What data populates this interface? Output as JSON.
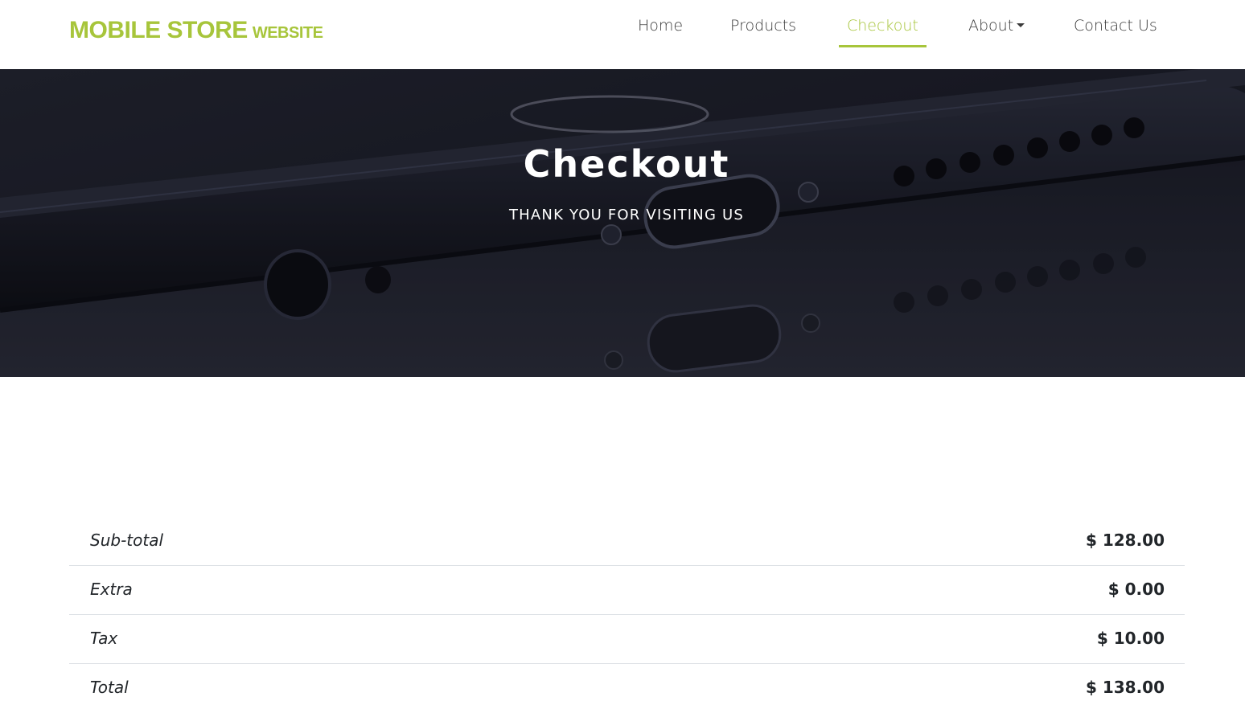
{
  "brand": {
    "name": "MOBILE STORE",
    "suffix": "WEBSITE",
    "color": "#a7c53b"
  },
  "nav": {
    "items": [
      {
        "label": "Home",
        "active": false
      },
      {
        "label": "Products",
        "active": false
      },
      {
        "label": "Checkout",
        "active": true
      },
      {
        "label": "About",
        "active": false,
        "has_dropdown": true
      },
      {
        "label": "Contact Us",
        "active": false
      }
    ]
  },
  "hero": {
    "title": "Checkout",
    "subtitle": "THANK YOU FOR VISITING US"
  },
  "summary": {
    "rows": [
      {
        "label": "Sub-total",
        "value": "$ 128.00"
      },
      {
        "label": "Extra",
        "value": "$ 0.00"
      },
      {
        "label": "Tax",
        "value": "$ 10.00"
      },
      {
        "label": "Total",
        "value": "$ 138.00"
      }
    ]
  }
}
